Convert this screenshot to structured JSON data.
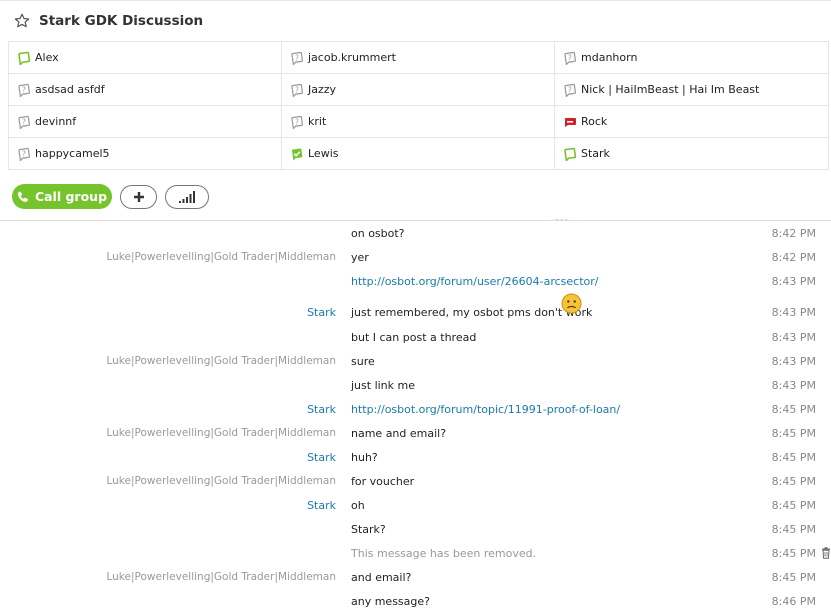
{
  "header": {
    "title": "Stark GDK Discussion",
    "icon": "star-outline-icon"
  },
  "participants": [
    {
      "name": "Alex",
      "status": "online"
    },
    {
      "name": "jacob.krummert",
      "status": "unknown"
    },
    {
      "name": "mdanhorn",
      "status": "unknown"
    },
    {
      "name": "asdsad asfdf",
      "status": "unknown"
    },
    {
      "name": "Jazzy",
      "status": "unknown"
    },
    {
      "name": "Nick | HaiImBeast | Hai Im Beast",
      "status": "unknown"
    },
    {
      "name": "devinnf",
      "status": "unknown"
    },
    {
      "name": "krit",
      "status": "unknown"
    },
    {
      "name": "Rock",
      "status": "busy"
    },
    {
      "name": "happycamel5",
      "status": "unknown"
    },
    {
      "name": "Lewis",
      "status": "online-verified"
    },
    {
      "name": "Stark",
      "status": "online"
    }
  ],
  "controls": {
    "call_group_label": "Call group",
    "more_indicator": "..."
  },
  "messages": [
    {
      "sender": "",
      "text": "on osbot?",
      "time": "8:42 PM",
      "kind": "text"
    },
    {
      "sender": "Luke|Powerlevelling|Gold Trader|Middleman",
      "text": "yer",
      "time": "8:42 PM",
      "kind": "text"
    },
    {
      "sender": "",
      "text": "http://osbot.org/forum/user/26604-arcsector/",
      "time": "8:43 PM",
      "kind": "link"
    },
    {
      "sender": "Stark",
      "text": "just remembered, my osbot pms don't work",
      "time": "8:43 PM",
      "kind": "text",
      "me": true,
      "emoji": "worried-face-emoji"
    },
    {
      "sender": "",
      "text": "but I can post a thread",
      "time": "8:43 PM",
      "kind": "text"
    },
    {
      "sender": "Luke|Powerlevelling|Gold Trader|Middleman",
      "text": "sure",
      "time": "8:43 PM",
      "kind": "text"
    },
    {
      "sender": "",
      "text": "just link me",
      "time": "8:43 PM",
      "kind": "text"
    },
    {
      "sender": "Stark",
      "text": "http://osbot.org/forum/topic/11991-proof-of-loan/",
      "time": "8:45 PM",
      "kind": "link",
      "me": true
    },
    {
      "sender": "Luke|Powerlevelling|Gold Trader|Middleman",
      "text": "name and email?",
      "time": "8:45 PM",
      "kind": "text"
    },
    {
      "sender": "Stark",
      "text": "huh?",
      "time": "8:45 PM",
      "kind": "text",
      "me": true
    },
    {
      "sender": "Luke|Powerlevelling|Gold Trader|Middleman",
      "text": "for voucher",
      "time": "8:45 PM",
      "kind": "text"
    },
    {
      "sender": "Stark",
      "text": "oh",
      "time": "8:45 PM",
      "kind": "text",
      "me": true
    },
    {
      "sender": "",
      "text": "Stark?",
      "time": "8:45 PM",
      "kind": "text"
    },
    {
      "sender": "",
      "text": "This message has been removed.",
      "time": "8:45 PM",
      "kind": "removed",
      "icon": "trash-icon"
    },
    {
      "sender": "Luke|Powerlevelling|Gold Trader|Middleman",
      "text": "and email?",
      "time": "8:45 PM",
      "kind": "text"
    },
    {
      "sender": "",
      "text": "any message?",
      "time": "8:46 PM",
      "kind": "text"
    }
  ],
  "colors": {
    "accent_green": "#76c42b",
    "link_blue": "#1a7aae",
    "busy_red": "#d0202c"
  }
}
